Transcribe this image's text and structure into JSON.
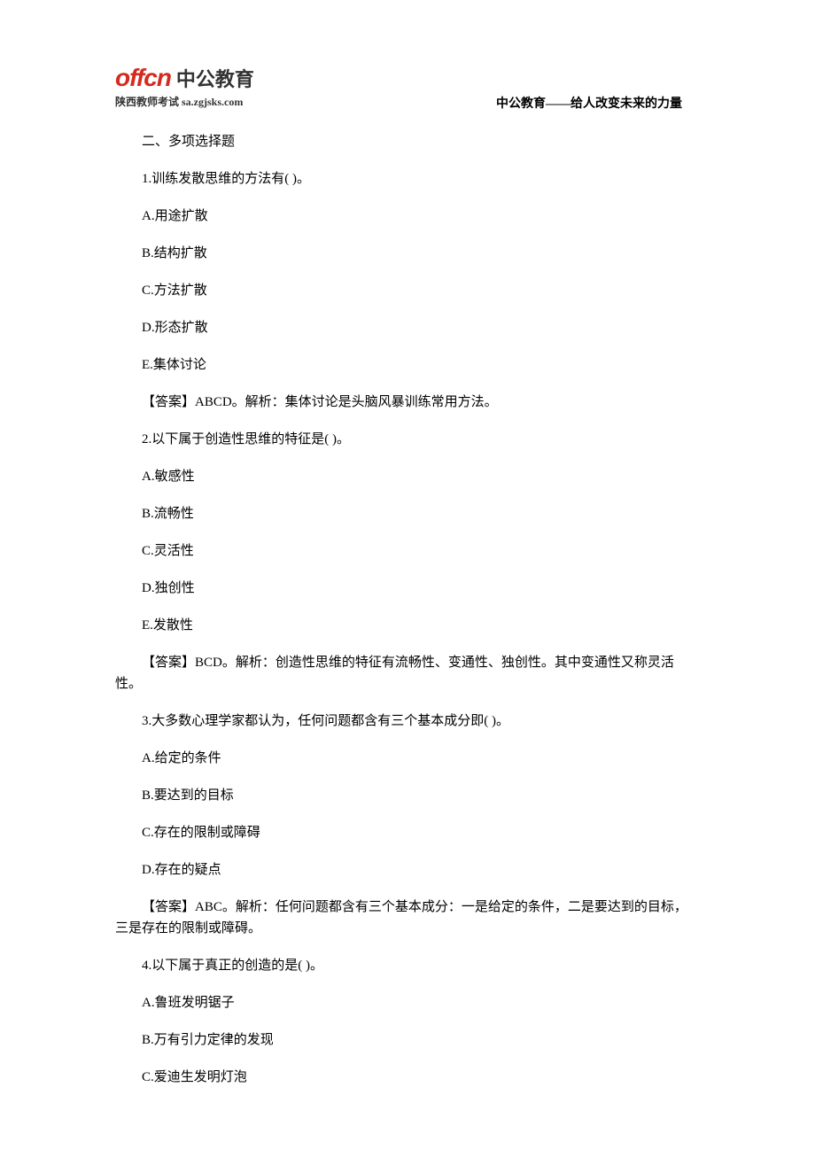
{
  "header": {
    "logo_en": "offcn",
    "logo_cn": "中公教育",
    "logo_sub": "陕西教师考试  sa.zgjsks.com",
    "slogan": "中公教育——给人改变未来的力量"
  },
  "content": {
    "section_title": "二、多项选择题",
    "q1": {
      "stem": "1.训练发散思维的方法有( )。",
      "a": "A.用途扩散",
      "b": "B.结构扩散",
      "c": "C.方法扩散",
      "d": "D.形态扩散",
      "e": "E.集体讨论",
      "answer": "【答案】ABCD。解析：集体讨论是头脑风暴训练常用方法。"
    },
    "q2": {
      "stem": "2.以下属于创造性思维的特征是( )。",
      "a": "A.敏感性",
      "b": "B.流畅性",
      "c": "C.灵活性",
      "d": "D.独创性",
      "e": "E.发散性",
      "answer": "【答案】BCD。解析：创造性思维的特征有流畅性、变通性、独创性。其中变通性又称灵活性。"
    },
    "q3": {
      "stem": "3.大多数心理学家都认为，任何问题都含有三个基本成分即( )。",
      "a": "A.给定的条件",
      "b": "B.要达到的目标",
      "c": "C.存在的限制或障碍",
      "d": "D.存在的疑点",
      "answer": "【答案】ABC。解析：任何问题都含有三个基本成分：一是给定的条件，二是要达到的目标，三是存在的限制或障碍。"
    },
    "q4": {
      "stem": "4.以下属于真正的创造的是( )。",
      "a": "A.鲁班发明锯子",
      "b": "B.万有引力定律的发现",
      "c": "C.爱迪生发明灯泡"
    }
  }
}
